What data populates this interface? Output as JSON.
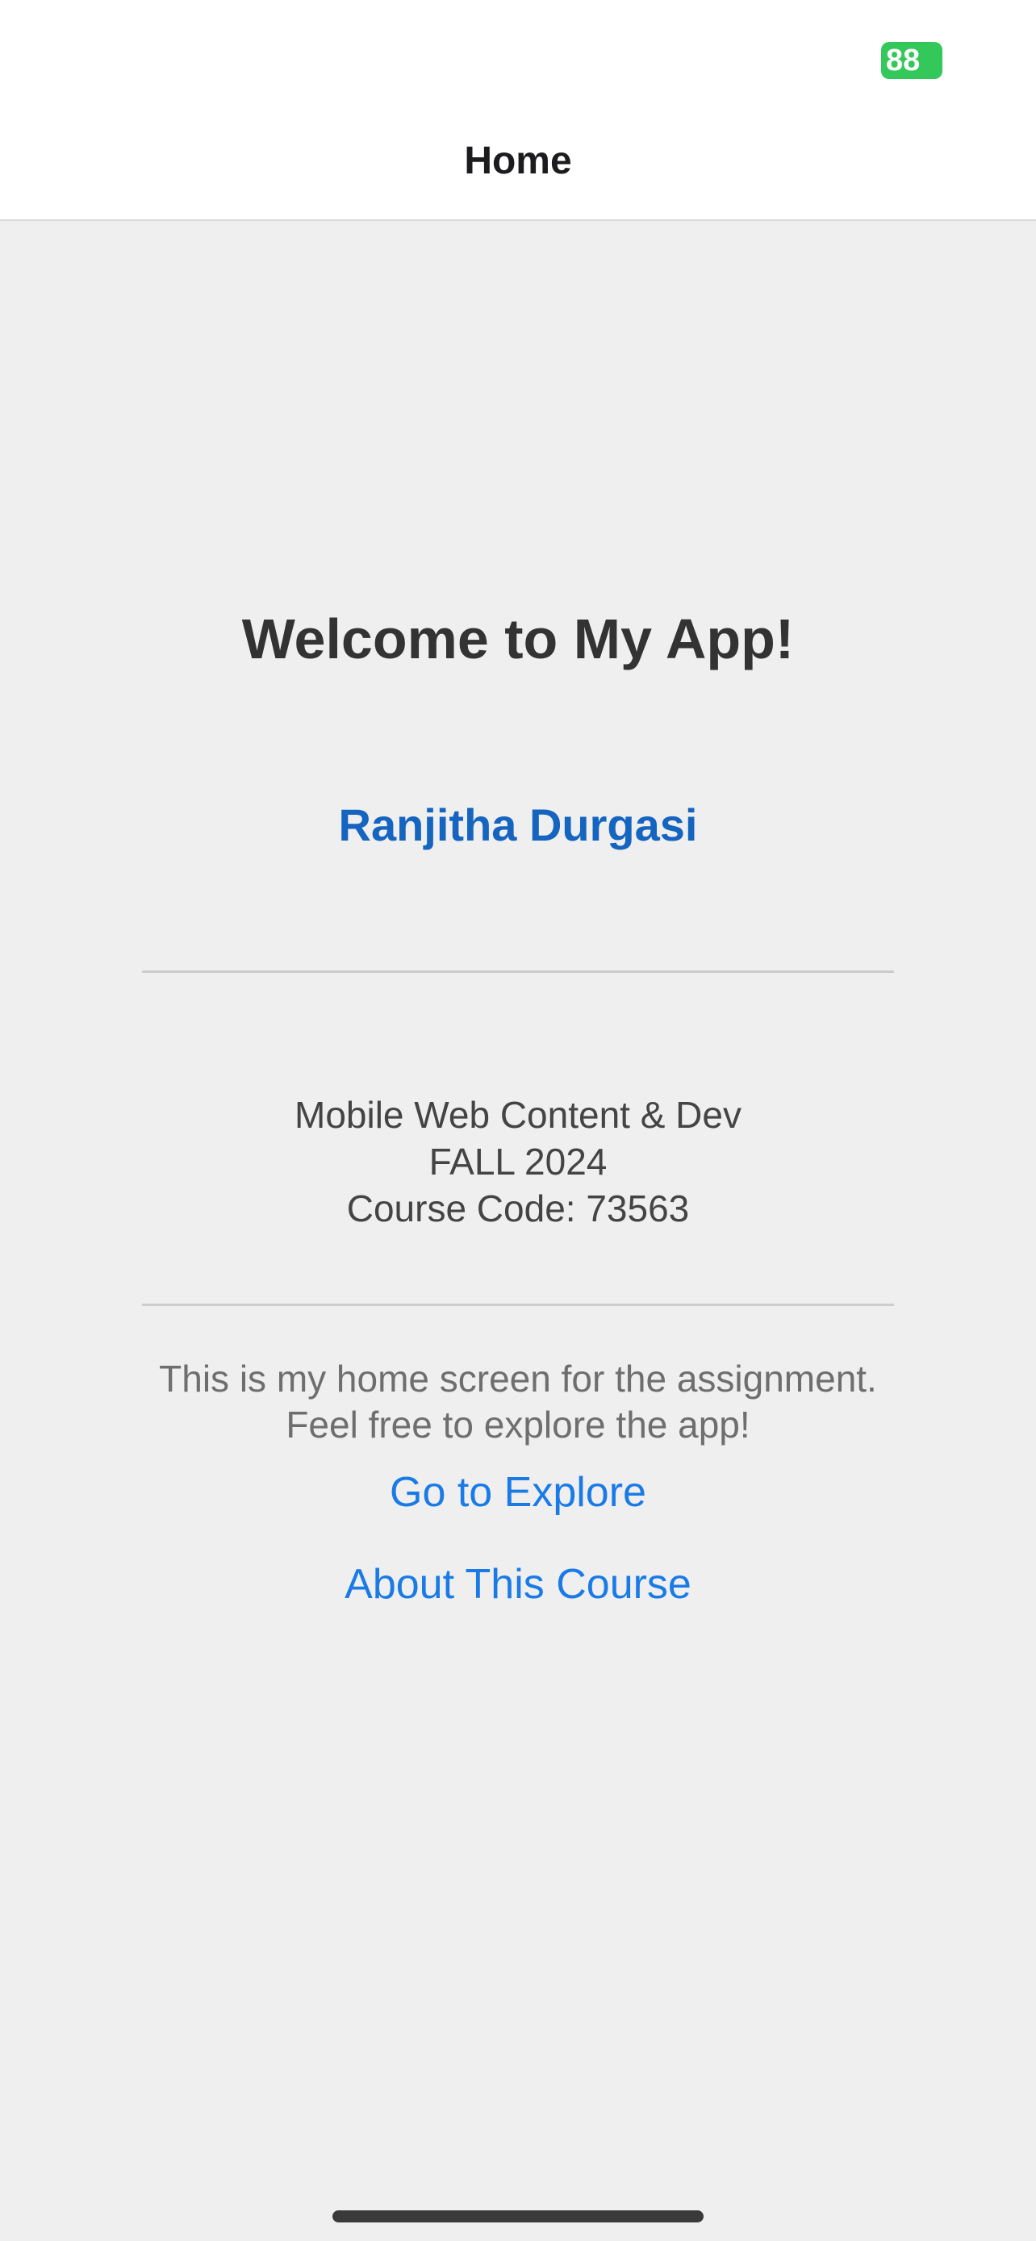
{
  "status_bar": {
    "battery_level": "88",
    "battery_color": "#34c759"
  },
  "header": {
    "title": "Home"
  },
  "main": {
    "welcome_title": "Welcome to My App!",
    "name": "Ranjitha Durgasi",
    "course_name": "Mobile Web Content & Dev",
    "term": "FALL 2024",
    "course_code": "Course Code: 73563",
    "description_line1": "This is my home screen for the assignment.",
    "description_line2": "Feel free to explore the app!",
    "explore_link": "Go to Explore",
    "about_link": "About This Course"
  },
  "colors": {
    "accent": "#1a7be6",
    "name_color": "#1565c0",
    "background": "#efefef"
  }
}
